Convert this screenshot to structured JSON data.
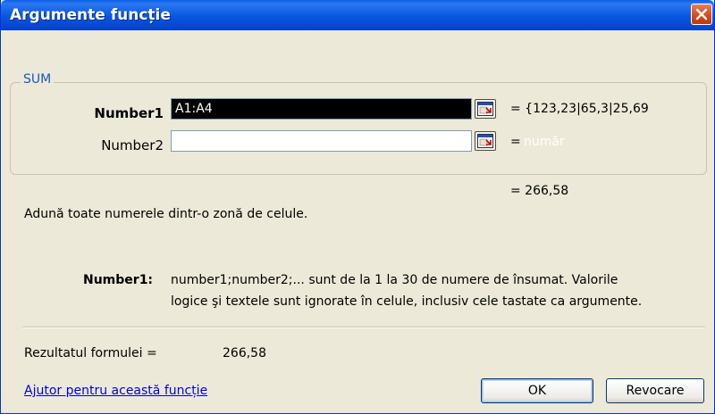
{
  "window": {
    "title": "Argumente funcție"
  },
  "function_group": {
    "label": "SUM"
  },
  "arguments": [
    {
      "label": "Number1",
      "value": "A1:A4",
      "result": "= {123,23|65,3|25,69"
    },
    {
      "label": "Number2",
      "value": "",
      "result_prefix": "=",
      "result_hint": "număr"
    }
  ],
  "function_result": "= 266,58",
  "description": "Adună toate numerele dintr-o zonă de celule.",
  "arg_help": {
    "name": "Number1:",
    "line1": "number1;number2;... sunt de la 1 la 30 de numere de însumat. Valorile",
    "line2": "logice şi textele sunt ignorate în celule, inclusiv cele tastate ca argumente."
  },
  "formula_result": {
    "label": "Rezultatul formulei =",
    "value": "266,58"
  },
  "help_link": "Ajutor pentru această funcție",
  "buttons": {
    "ok": "OK",
    "cancel": "Revocare"
  },
  "icons": {
    "close": "close-icon",
    "collapse": "collapse-dialog-icon"
  }
}
